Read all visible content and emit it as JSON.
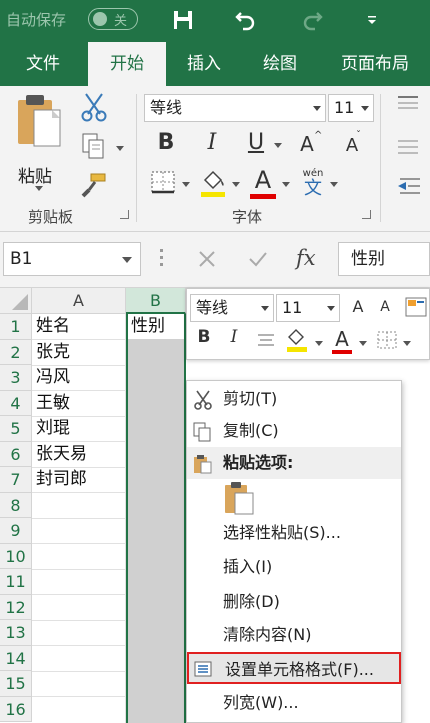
{
  "titlebar": {
    "autosave_label": "自动保存",
    "toggle_label": "关",
    "icons": [
      "save-icon",
      "undo-icon",
      "redo-icon",
      "customize-qat-icon"
    ]
  },
  "tabs": [
    {
      "label": "文件",
      "active": false
    },
    {
      "label": "开始",
      "active": true
    },
    {
      "label": "插入",
      "active": false
    },
    {
      "label": "绘图",
      "active": false
    },
    {
      "label": "页面布局",
      "active": false
    }
  ],
  "ribbon": {
    "paste_label": "粘贴",
    "clipboard_label": "剪贴板",
    "font_group_label": "字体",
    "font_name": "等线",
    "font_size": "11",
    "bold": "B",
    "italic": "I",
    "underline": "U",
    "grow_font": "A",
    "shrink_font": "A",
    "font_color_letter": "A",
    "phonetic_top": "wén",
    "phonetic_char": "文"
  },
  "formula_bar": {
    "name_box": "B1",
    "fx": "fx",
    "value": "性别"
  },
  "grid": {
    "columns": [
      "A",
      "B"
    ],
    "rows": [
      "1",
      "2",
      "3",
      "4",
      "5",
      "6",
      "7",
      "8",
      "9",
      "10",
      "11",
      "12",
      "13",
      "14",
      "15",
      "16"
    ],
    "col_a_values": [
      "姓名",
      "张克",
      "冯风",
      "王敏",
      "刘琨",
      "张天易",
      "封司郎"
    ],
    "b1_value": "性别"
  },
  "mini_toolbar": {
    "font_name": "等线",
    "font_size": "11",
    "bold": "B",
    "italic": "I",
    "font_color_letter": "A",
    "grow_font": "A",
    "shrink_font": "A"
  },
  "context_menu": [
    {
      "label": "剪切(T)",
      "icon": "scissors-icon"
    },
    {
      "label": "复制(C)",
      "icon": "copy-icon"
    },
    {
      "label": "粘贴选项:",
      "icon": "paste-icon",
      "header": true
    },
    {
      "label": "选择性粘贴(S)...",
      "icon": ""
    },
    {
      "label": "插入(I)",
      "icon": ""
    },
    {
      "label": "删除(D)",
      "icon": ""
    },
    {
      "label": "清除内容(N)",
      "icon": ""
    },
    {
      "label": "设置单元格格式(F)...",
      "icon": "format-cells-icon",
      "highlighted": true
    },
    {
      "label": "列宽(W)...",
      "icon": ""
    }
  ],
  "colors": {
    "brand": "#217346",
    "highlight_yellow": "#f5e500",
    "font_red": "#e00000",
    "callout_red": "#e02020"
  }
}
